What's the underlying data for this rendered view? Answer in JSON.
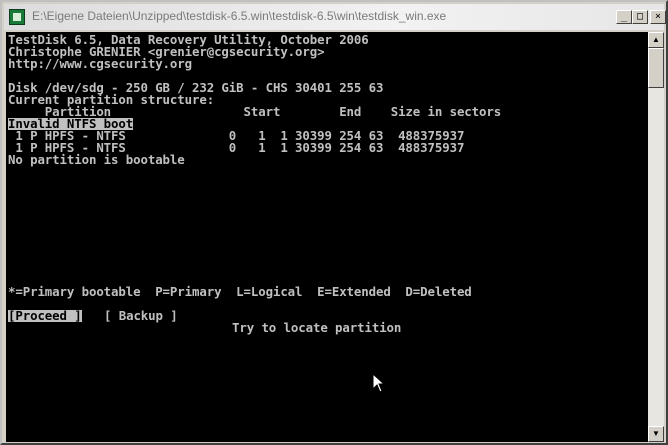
{
  "window": {
    "title": "E:\\Eigene Dateien\\Unzipped\\testdisk-6.5.win\\testdisk-6.5\\win\\testdisk_win.exe",
    "controls": {
      "minimize": "_",
      "maximize": "□",
      "close": "×"
    }
  },
  "console": {
    "header": [
      "TestDisk 6.5, Data Recovery Utility, October 2006",
      "Christophe GRENIER <grenier@cgsecurity.org>",
      "http://www.cgsecurity.org"
    ],
    "disk_info": "Disk /dev/sdg - 250 GB / 232 GiB - CHS 30401 255 63",
    "structure_label": "Current partition structure:",
    "columns_header": "     Partition                  Start        End    Size in sectors",
    "warning": "Invalid NTFS boot",
    "partitions": [
      " 1 P HPFS - NTFS              0   1  1 30399 254 63  488375937",
      " 1 P HPFS - NTFS              0   1  1 30399 254 63  488375937"
    ],
    "bootable_note": "No partition is bootable",
    "legend": "*=Primary bootable  P=Primary  L=Logical  E=Extended  D=Deleted",
    "menu": {
      "proceed": "[Proceed ]",
      "backup": "[ Backup ]"
    },
    "hint": "Try to locate partition"
  },
  "icons": {
    "app": "testdisk-app-icon",
    "cursor": "mouse-pointer-icon"
  },
  "colors": {
    "console_bg": "#000000",
    "console_text": "#c0c0c0",
    "highlight_bg": "#c0c0c0",
    "highlight_text": "#000000"
  }
}
